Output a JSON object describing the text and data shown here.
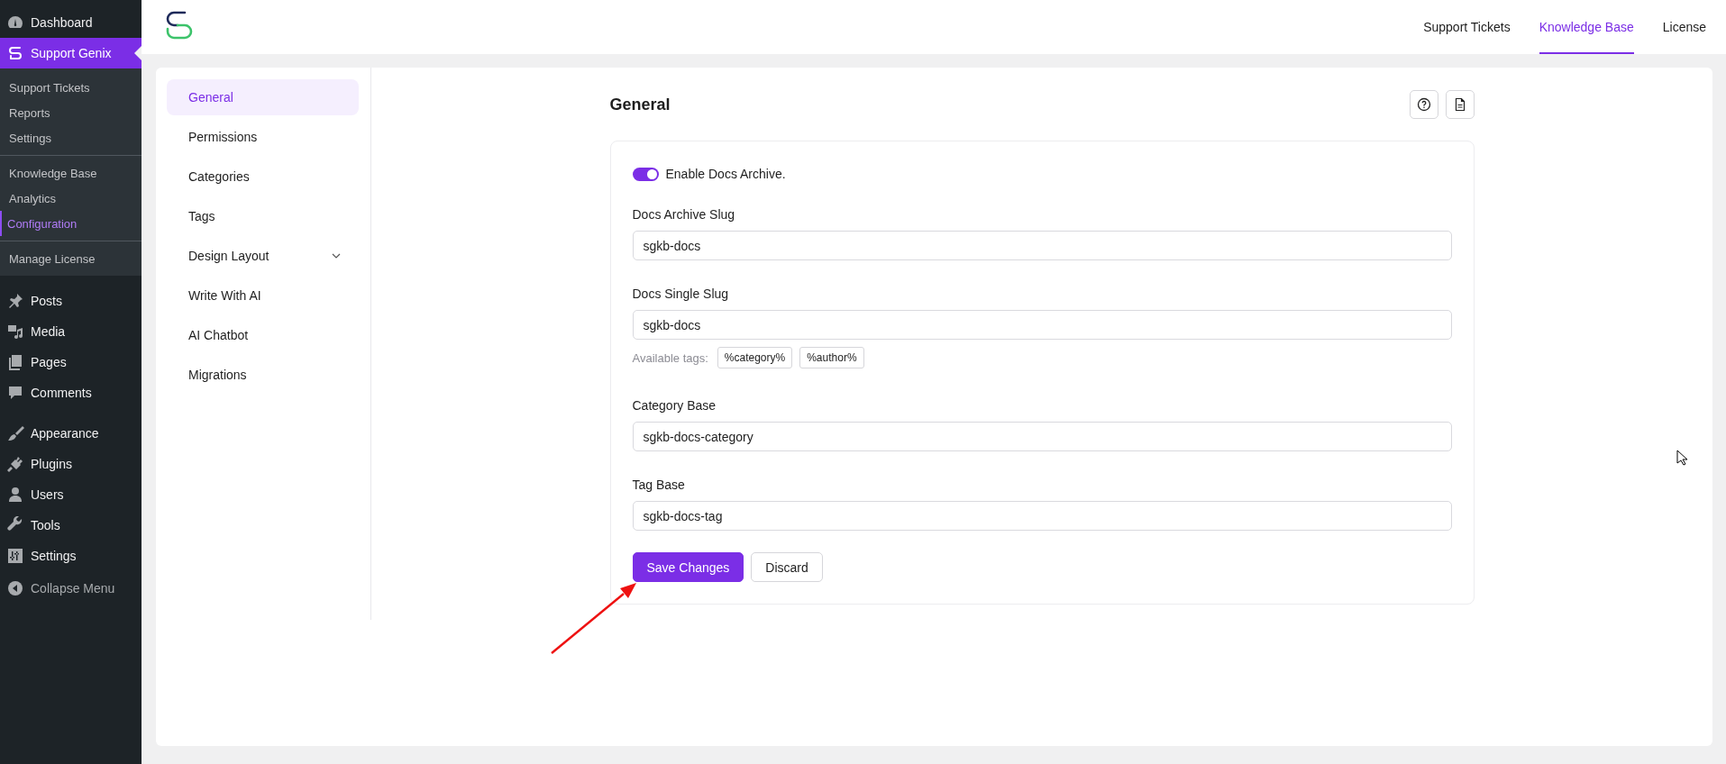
{
  "admin_menu": {
    "groups": [
      [
        {
          "label": "Dashboard",
          "selected": false
        },
        {
          "label": "Support Genix",
          "selected": true,
          "submenu": [
            [
              {
                "label": "Support Tickets",
                "selected": false
              },
              {
                "label": "Reports",
                "selected": false
              },
              {
                "label": "Settings",
                "selected": false
              }
            ],
            [
              {
                "label": "Knowledge Base",
                "selected": false
              },
              {
                "label": "Analytics",
                "selected": false
              },
              {
                "label": "Configuration",
                "selected": true
              }
            ],
            [
              {
                "label": "Manage License",
                "selected": false
              }
            ]
          ]
        }
      ],
      [
        {
          "label": "Posts",
          "selected": false
        },
        {
          "label": "Media",
          "selected": false
        },
        {
          "label": "Pages",
          "selected": false
        },
        {
          "label": "Comments",
          "selected": false
        }
      ],
      [
        {
          "label": "Appearance",
          "selected": false
        },
        {
          "label": "Plugins",
          "selected": false
        },
        {
          "label": "Users",
          "selected": false
        },
        {
          "label": "Tools",
          "selected": false
        },
        {
          "label": "Settings",
          "selected": false
        }
      ]
    ],
    "collapse_label": "Collapse Menu"
  },
  "header": {
    "tabs": [
      {
        "label": "Support Tickets",
        "selected": false
      },
      {
        "label": "Knowledge Base",
        "selected": true
      },
      {
        "label": "License",
        "selected": false
      }
    ]
  },
  "settings_nav": {
    "items": [
      {
        "label": "General",
        "selected": true,
        "expandable": false
      },
      {
        "label": "Permissions",
        "selected": false,
        "expandable": false
      },
      {
        "label": "Categories",
        "selected": false,
        "expandable": false
      },
      {
        "label": "Tags",
        "selected": false,
        "expandable": false
      },
      {
        "label": "Design Layout",
        "selected": false,
        "expandable": true
      },
      {
        "label": "Write With AI",
        "selected": false,
        "expandable": false
      },
      {
        "label": "AI Chatbot",
        "selected": false,
        "expandable": false
      },
      {
        "label": "Migrations",
        "selected": false,
        "expandable": false
      }
    ]
  },
  "content": {
    "title": "General",
    "toggle": {
      "label": "Enable Docs Archive.",
      "on": true
    },
    "fields": [
      {
        "label": "Docs Archive Slug",
        "value": "sgkb-docs"
      },
      {
        "label": "Docs Single Slug",
        "value": "sgkb-docs",
        "tags_label": "Available tags:",
        "tags": [
          "%category%",
          "%author%"
        ]
      },
      {
        "label": "Category Base",
        "value": "sgkb-docs-category"
      },
      {
        "label": "Tag Base",
        "value": "sgkb-docs-tag"
      }
    ],
    "buttons": [
      {
        "label": "Save Changes",
        "kind": "primary"
      },
      {
        "label": "Discard",
        "kind": "secondary"
      }
    ]
  }
}
